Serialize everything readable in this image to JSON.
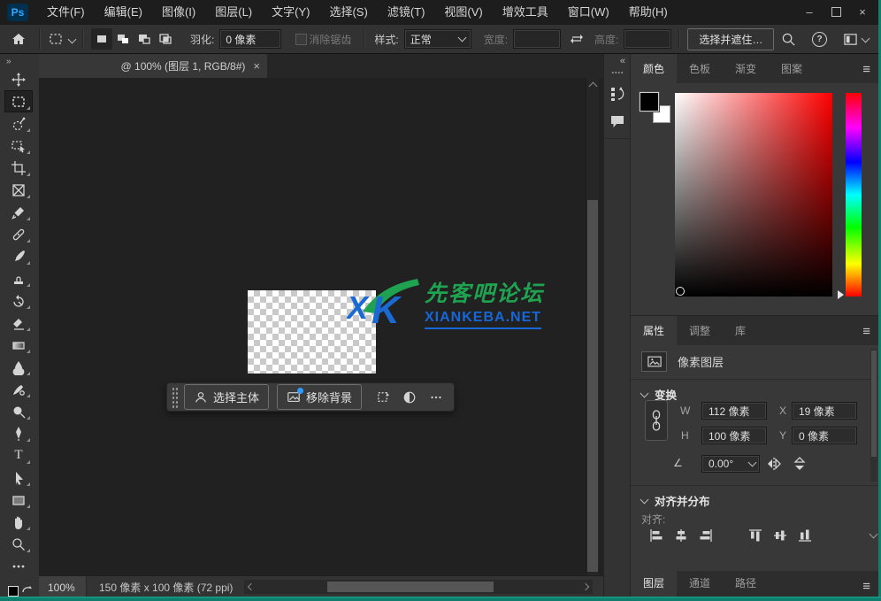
{
  "menu": {
    "logo": "Ps",
    "items": [
      "文件(F)",
      "编辑(E)",
      "图像(I)",
      "图层(L)",
      "文字(Y)",
      "选择(S)",
      "滤镜(T)",
      "视图(V)",
      "增效工具",
      "窗口(W)",
      "帮助(H)"
    ]
  },
  "window_controls": {
    "minimize": "–",
    "close": "×"
  },
  "options": {
    "feather_label": "羽化:",
    "feather_value": "0 像素",
    "antialias_label": "消除锯齿",
    "style_label": "样式:",
    "style_value": "正常",
    "width_label": "宽度:",
    "width_value": "",
    "height_label": "高度:",
    "height_value": "",
    "select_and_mask_label": "选择并遮住…"
  },
  "tools": [
    "move",
    "rectangular-marquee",
    "quick-selection",
    "object-selection",
    "crop",
    "frame",
    "eyedropper",
    "spot-healing-brush",
    "brush",
    "clone-stamp",
    "history-brush",
    "eraser",
    "gradient",
    "blur",
    "smudge",
    "dodge",
    "pen",
    "type",
    "path-selection",
    "rectangle",
    "hand",
    "zoom",
    "edit-toolbar"
  ],
  "document": {
    "tab_title": "@ 100% (图层 1, RGB/8#)",
    "tab_close": "×",
    "zoom_level": "100%",
    "size_info": "150 像素 x 100 像素 (72 ppi)"
  },
  "watermark": {
    "logo": "XK",
    "title": "先客吧论坛",
    "url": "XIANKEBA.NET",
    "green": "#1fa351",
    "blue": "#1667d9"
  },
  "taskbar": {
    "select_subject": "选择主体",
    "remove_background": "移除背景"
  },
  "color_panel": {
    "tabs": [
      "颜色",
      "色板",
      "渐变",
      "图案"
    ],
    "active_tab": "颜色",
    "foreground": "#000000",
    "background": "#ffffff"
  },
  "properties": {
    "tabs": [
      "属性",
      "调整",
      "库"
    ],
    "active_tab": "属性",
    "layer_type": "像素图层",
    "transform": {
      "title": "变换",
      "w_label": "W",
      "w_value": "112 像素",
      "x_label": "X",
      "x_value": "19 像素",
      "h_label": "H",
      "h_value": "100 像素",
      "y_label": "Y",
      "y_value": "0 像素",
      "angle_value": "0.00°"
    },
    "align": {
      "title": "对齐并分布",
      "align_label": "对齐:"
    }
  },
  "layers_panel": {
    "tabs": [
      "图层",
      "通道",
      "路径"
    ],
    "active_tab": "图层"
  },
  "icons": [
    "home-icon",
    "marquee-preset-icon",
    "new-selection-icon",
    "add-selection-icon",
    "subtract-selection-icon",
    "intersect-selection-icon",
    "swap-dimensions-icon",
    "search-icon",
    "help-icon",
    "workspace-icon",
    "history-panel-icon",
    "comments-panel-icon",
    "link-icon",
    "flip-horizontal-icon",
    "flip-vertical-icon",
    "angle-icon",
    "align-left-icon",
    "align-center-h-icon",
    "align-right-icon",
    "align-top-icon",
    "align-middle-icon",
    "align-bottom-icon"
  ],
  "colors": {
    "teal_border": "#0d7f6f",
    "accent_blue": "#31a8ff"
  }
}
